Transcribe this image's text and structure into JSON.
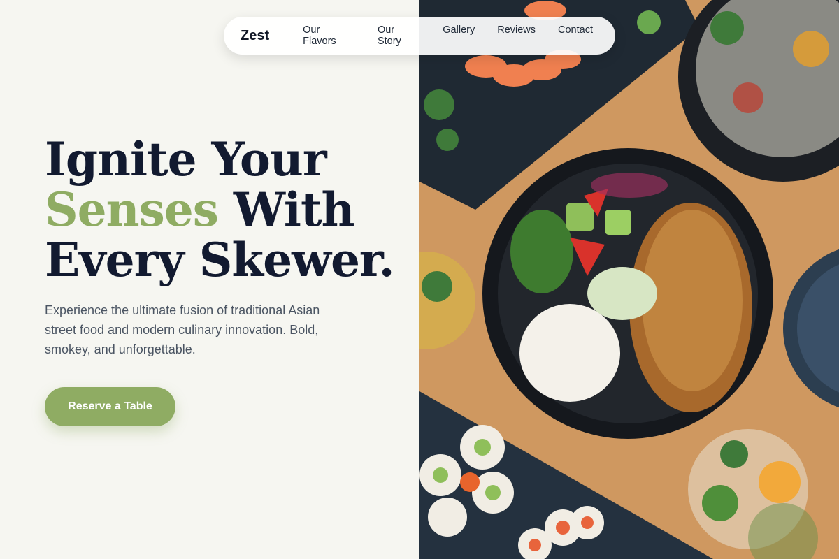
{
  "nav": {
    "logo": "Zest",
    "links": [
      "Our Flavors",
      "Our Story",
      "Gallery",
      "Reviews",
      "Contact"
    ]
  },
  "hero": {
    "headline_line1": "Ignite Your",
    "headline_accent": "Senses",
    "headline_line2_rest": " With",
    "headline_line3": "Every Skewer.",
    "subtext": "Experience the ultimate fusion of traditional Asian street food and modern culinary innovation. Bold, smokey, and unforgettable.",
    "cta_label": "Reserve a Table"
  },
  "colors": {
    "accent": "#8fac63",
    "heading": "#121a30",
    "background": "#f6f6f1"
  },
  "image": {
    "icon": "food-photo-icon"
  }
}
